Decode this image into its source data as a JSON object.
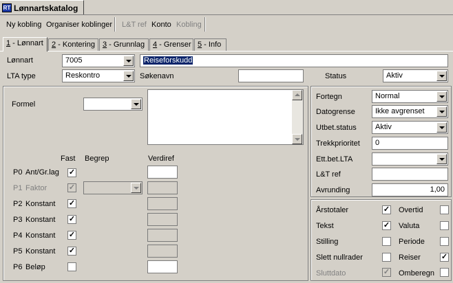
{
  "window": {
    "title": "Lønnartskatalog"
  },
  "toolbar": {
    "group1": [
      "Ny kobling",
      "Organiser koblinger"
    ],
    "group2": [
      "L&T ref",
      "Konto",
      "Kobling"
    ]
  },
  "tabs": [
    {
      "num": "1",
      "label": " - Lønnart"
    },
    {
      "num": "2",
      "label": " - Kontering"
    },
    {
      "num": "3",
      "label": " - Grunnlag"
    },
    {
      "num": "4",
      "label": " - Grenser"
    },
    {
      "num": "5",
      "label": " - Info"
    }
  ],
  "header": {
    "lonnart_label": "Lønnart",
    "lonnart_value": "7005",
    "description_value": "Reiseforskudd",
    "lta_type_label": "LTA type",
    "lta_type_value": "Reskontro",
    "sokenavn_label": "Søkenavn",
    "sokenavn_value": "",
    "status_label": "Status",
    "status_value": "Aktiv"
  },
  "formula": {
    "label": "Formel",
    "value": "",
    "text": ""
  },
  "params": {
    "col_fast": "Fast",
    "col_begrep": "Begrep",
    "col_verdiref": "Verdiref",
    "rows": [
      {
        "code": "P0",
        "name": "Ant/Gr.lag",
        "checked": true,
        "disabled": false
      },
      {
        "code": "P1",
        "name": "Faktor",
        "checked": true,
        "disabled": true
      },
      {
        "code": "P2",
        "name": "Konstant",
        "checked": true,
        "disabled": false
      },
      {
        "code": "P3",
        "name": "Konstant",
        "checked": true,
        "disabled": false
      },
      {
        "code": "P4",
        "name": "Konstant",
        "checked": true,
        "disabled": false
      },
      {
        "code": "P5",
        "name": "Konstant",
        "checked": true,
        "disabled": false
      },
      {
        "code": "P6",
        "name": "Beløp",
        "checked": false,
        "disabled": false
      }
    ]
  },
  "right": {
    "fortegn_label": "Fortegn",
    "fortegn_value": "Normal",
    "datogrense_label": "Datogrense",
    "datogrense_value": "Ikke avgrenset",
    "utbet_label": "Utbet.status",
    "utbet_value": "Aktiv",
    "trekk_label": "Trekkprioritet",
    "trekk_value": "0",
    "ettbet_label": "Ett.bet.LTA",
    "ettbet_value": "",
    "ltref_label": "L&T ref",
    "ltref_value": "",
    "avrunding_label": "Avrunding",
    "avrunding_value": "1,00"
  },
  "flags": {
    "left": [
      {
        "label": "Årstotaler",
        "checked": true,
        "disabled": false
      },
      {
        "label": "Tekst",
        "checked": true,
        "disabled": false
      },
      {
        "label": "Stilling",
        "checked": false,
        "disabled": false
      },
      {
        "label": "Slett nullrader",
        "checked": false,
        "disabled": false
      },
      {
        "label": "Sluttdato",
        "checked": true,
        "disabled": true
      }
    ],
    "right": [
      {
        "label": "Overtid",
        "checked": false,
        "disabled": false
      },
      {
        "label": "Valuta",
        "checked": false,
        "disabled": false
      },
      {
        "label": "Periode",
        "checked": false,
        "disabled": false
      },
      {
        "label": "Reiser",
        "checked": true,
        "disabled": false
      },
      {
        "label": "Omberegn",
        "checked": false,
        "disabled": false
      }
    ]
  }
}
